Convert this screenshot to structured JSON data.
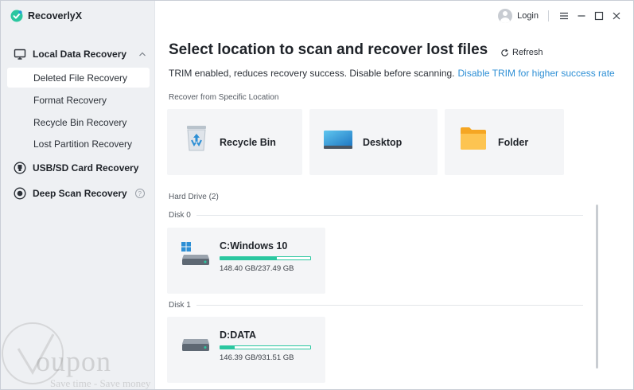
{
  "app": {
    "name": "RecoverlyX",
    "accent_color": "#2bc7a0",
    "link_color": "#2d8fd5"
  },
  "topbar": {
    "login_label": "Login",
    "menu_icon": "hamburger-icon",
    "minimize_icon": "minimize-icon",
    "maximize_icon": "maximize-icon",
    "close_icon": "close-icon"
  },
  "sidebar": {
    "sections": [
      {
        "label": "Local Data Recovery",
        "icon": "monitor-icon",
        "expanded": true
      },
      {
        "label": "USB/SD Card Recovery",
        "icon": "usb-icon"
      },
      {
        "label": "Deep Scan Recovery",
        "icon": "deep-scan-icon",
        "help": "?"
      }
    ],
    "sub_items": [
      {
        "label": "Deleted File Recovery",
        "active": true
      },
      {
        "label": "Format Recovery"
      },
      {
        "label": "Recycle Bin Recovery"
      },
      {
        "label": "Lost Partition Recovery"
      }
    ]
  },
  "main": {
    "title": "Select location to scan and recover lost files",
    "refresh_label": "Refresh",
    "trim_notice": "TRIM enabled, reduces recovery success. Disable before scanning.",
    "trim_link": "Disable TRIM for higher success rate",
    "specific_location_label": "Recover from Specific Location",
    "locations": [
      {
        "label": "Recycle Bin",
        "icon": "recycle-bin-icon"
      },
      {
        "label": "Desktop",
        "icon": "desktop-icon"
      },
      {
        "label": "Folder",
        "icon": "folder-icon"
      }
    ],
    "hard_drive_label": "Hard Drive (2)",
    "disks": [
      {
        "label": "Disk 0",
        "drive": {
          "name": "C:Windows 10",
          "size": "148.40 GB/237.49 GB",
          "used_fraction": 0.625,
          "os_icon": "windows-logo-icon"
        }
      },
      {
        "label": "Disk 1",
        "drive": {
          "name": "D:DATA",
          "size": "146.39 GB/931.51 GB",
          "used_fraction": 0.157
        }
      }
    ]
  },
  "watermark": {
    "text": "oupon",
    "subtext": "Save time - Save money"
  }
}
